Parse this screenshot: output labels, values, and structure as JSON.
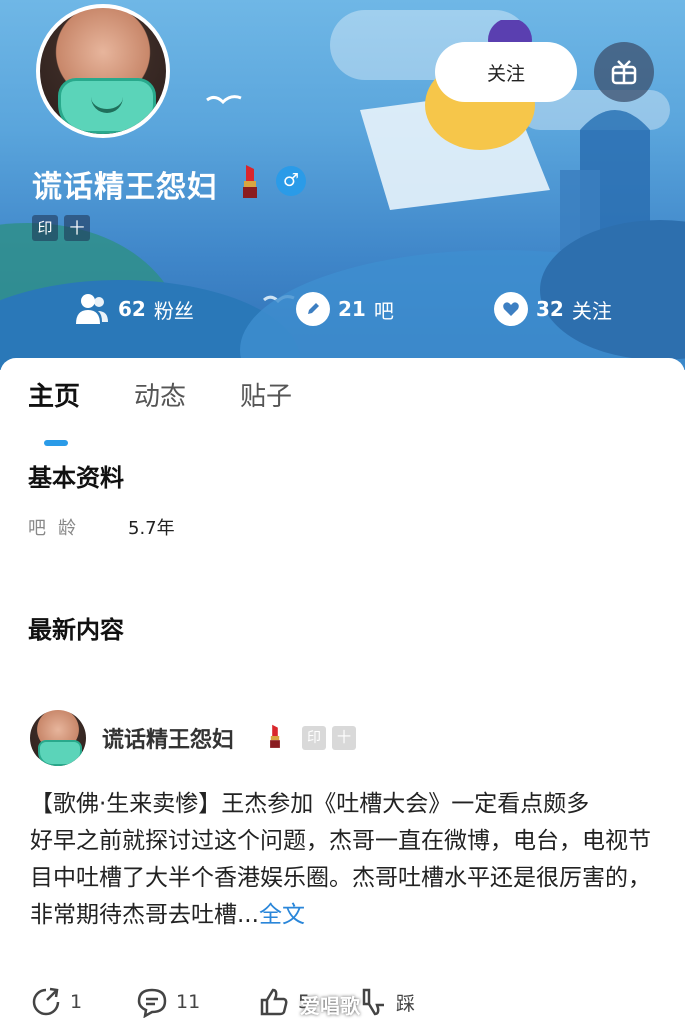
{
  "header": {
    "follow_label": "关注",
    "username": "谎话精王怨妇",
    "badges": [
      "印",
      "十"
    ],
    "stats": [
      {
        "num": "62",
        "label": "粉丝",
        "icon": "users-icon"
      },
      {
        "num": "21",
        "label": "吧",
        "icon": "pencil-icon"
      },
      {
        "num": "32",
        "label": "关注",
        "icon": "heart-icon"
      }
    ]
  },
  "tabs": [
    "主页",
    "动态",
    "贴子"
  ],
  "profile": {
    "section_title": "基本资料",
    "age_label": "吧龄",
    "age_value": "5.7年"
  },
  "latest": {
    "section_title": "最新内容",
    "post": {
      "author": "谎话精王怨妇",
      "badges": [
        "印",
        "十"
      ],
      "title": "【歌佛·生来卖惨】王杰参加《吐槽大会》一定看点颇多",
      "body": "好早之前就探讨过这个问题，杰哥一直在微博，电台，电视节目中吐槽了大半个香港娱乐圈。杰哥吐槽水平还是很厉害的，非常期待杰哥去吐槽...",
      "more_label": "全文",
      "actions": {
        "share_count": "1",
        "comment_count": "11",
        "like_count": "5",
        "dislike_label": "踩"
      }
    }
  },
  "watermark": "爱唱歌",
  "colors": {
    "accent": "#2a9be8",
    "link": "#2a86d9",
    "banner": "#5aa5dc"
  }
}
